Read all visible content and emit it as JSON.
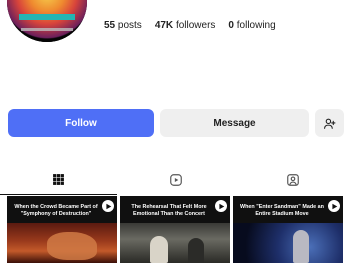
{
  "profile": {
    "avatar_icon": "band-logo-avatar"
  },
  "stats": {
    "posts_count": "55",
    "posts_label": "posts",
    "followers_count": "47K",
    "followers_label": "followers",
    "following_count": "0",
    "following_label": "following"
  },
  "actions": {
    "follow_label": "Follow",
    "message_label": "Message",
    "add_user_icon": "add-user-icon",
    "follow_color": "#4f6ff6"
  },
  "tabs": [
    {
      "icon": "grid-icon",
      "active": true
    },
    {
      "icon": "reels-icon",
      "active": false
    },
    {
      "icon": "tagged-icon",
      "active": false
    }
  ],
  "posts": [
    {
      "caption": "When the Crowd Became Part of \"Symphony of Destruction\"",
      "icon": "play-icon"
    },
    {
      "caption": "The Rehearsal That Felt More Emotional Than the Concert",
      "icon": "play-icon"
    },
    {
      "caption": "When \"Enter Sandman\" Made an Entire Stadium Move",
      "icon": "play-icon"
    }
  ]
}
